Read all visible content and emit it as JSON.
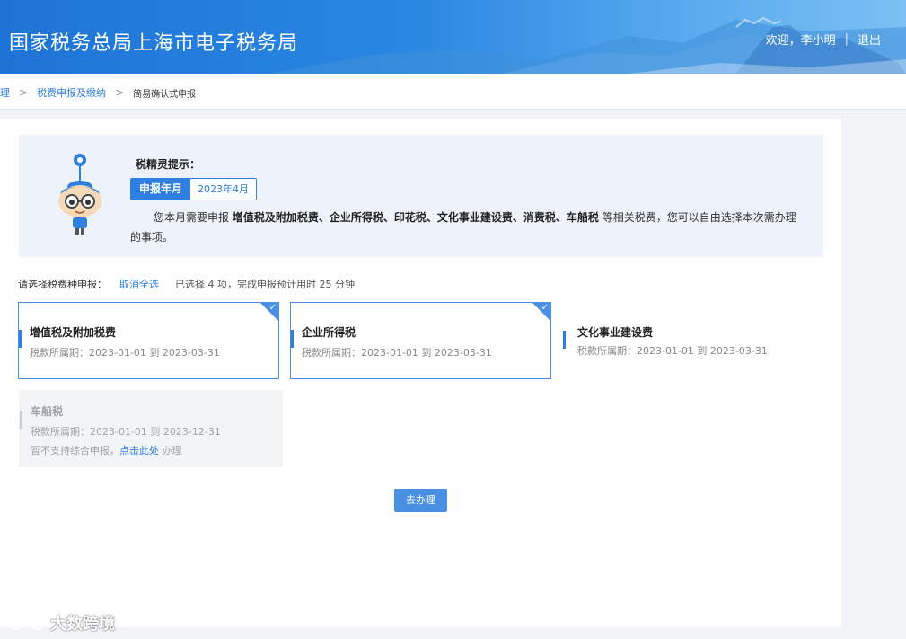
{
  "header": {
    "title": "国家税务总局上海市电子税务局",
    "welcome": "欢迎，李小明",
    "separator": "|",
    "logout": "退出"
  },
  "breadcrumb": {
    "partial": "理",
    "sep1": ">",
    "item1": "税费申报及缴纳",
    "sep2": ">",
    "current": "简易确认式申报"
  },
  "tip": {
    "title": "税精灵提示：",
    "period_label": "申报年月",
    "period_value": "2023年4月",
    "text_prefix": "您本月需要申报",
    "taxes_bold": "增值税及附加税费、企业所得税、印花税、文化事业建设费、消费税、车船税",
    "text_suffix": "等相关税费，您可以自由选择本次需办理的事项。"
  },
  "selection": {
    "label": "请选择税费种申报：",
    "cancel_all": "取消全选",
    "info": "已选择 4 项，完成申报预计用时 25 分钟"
  },
  "cards": [
    {
      "name": "增值税及附加税费",
      "period": "税款所属期：2023-01-01 到 2023-03-31",
      "state": "selected"
    },
    {
      "name": "企业所得税",
      "period": "税款所属期：2023-01-01 到 2023-03-31",
      "state": "selected"
    },
    {
      "name": "文化事业建设费",
      "period": "税款所属期：2023-01-01 到 2023-03-31",
      "state": "unselected"
    },
    {
      "name": "车船税",
      "period": "税款所属期：2023-01-01 到 2023-12-31",
      "state": "disabled",
      "note_prefix": "暂不支持综合申报，",
      "note_link": "点击此处",
      "note_suffix": " 办理"
    }
  ],
  "actions": {
    "go": "去办理"
  },
  "watermark": {
    "text": "大数跨境"
  },
  "colors": {
    "accent": "#2f7fe0",
    "selected_border": "#4a90e2",
    "tip_bg": "#eef3fb"
  },
  "icons": {
    "checkmark": "✓",
    "chevron": ">"
  }
}
